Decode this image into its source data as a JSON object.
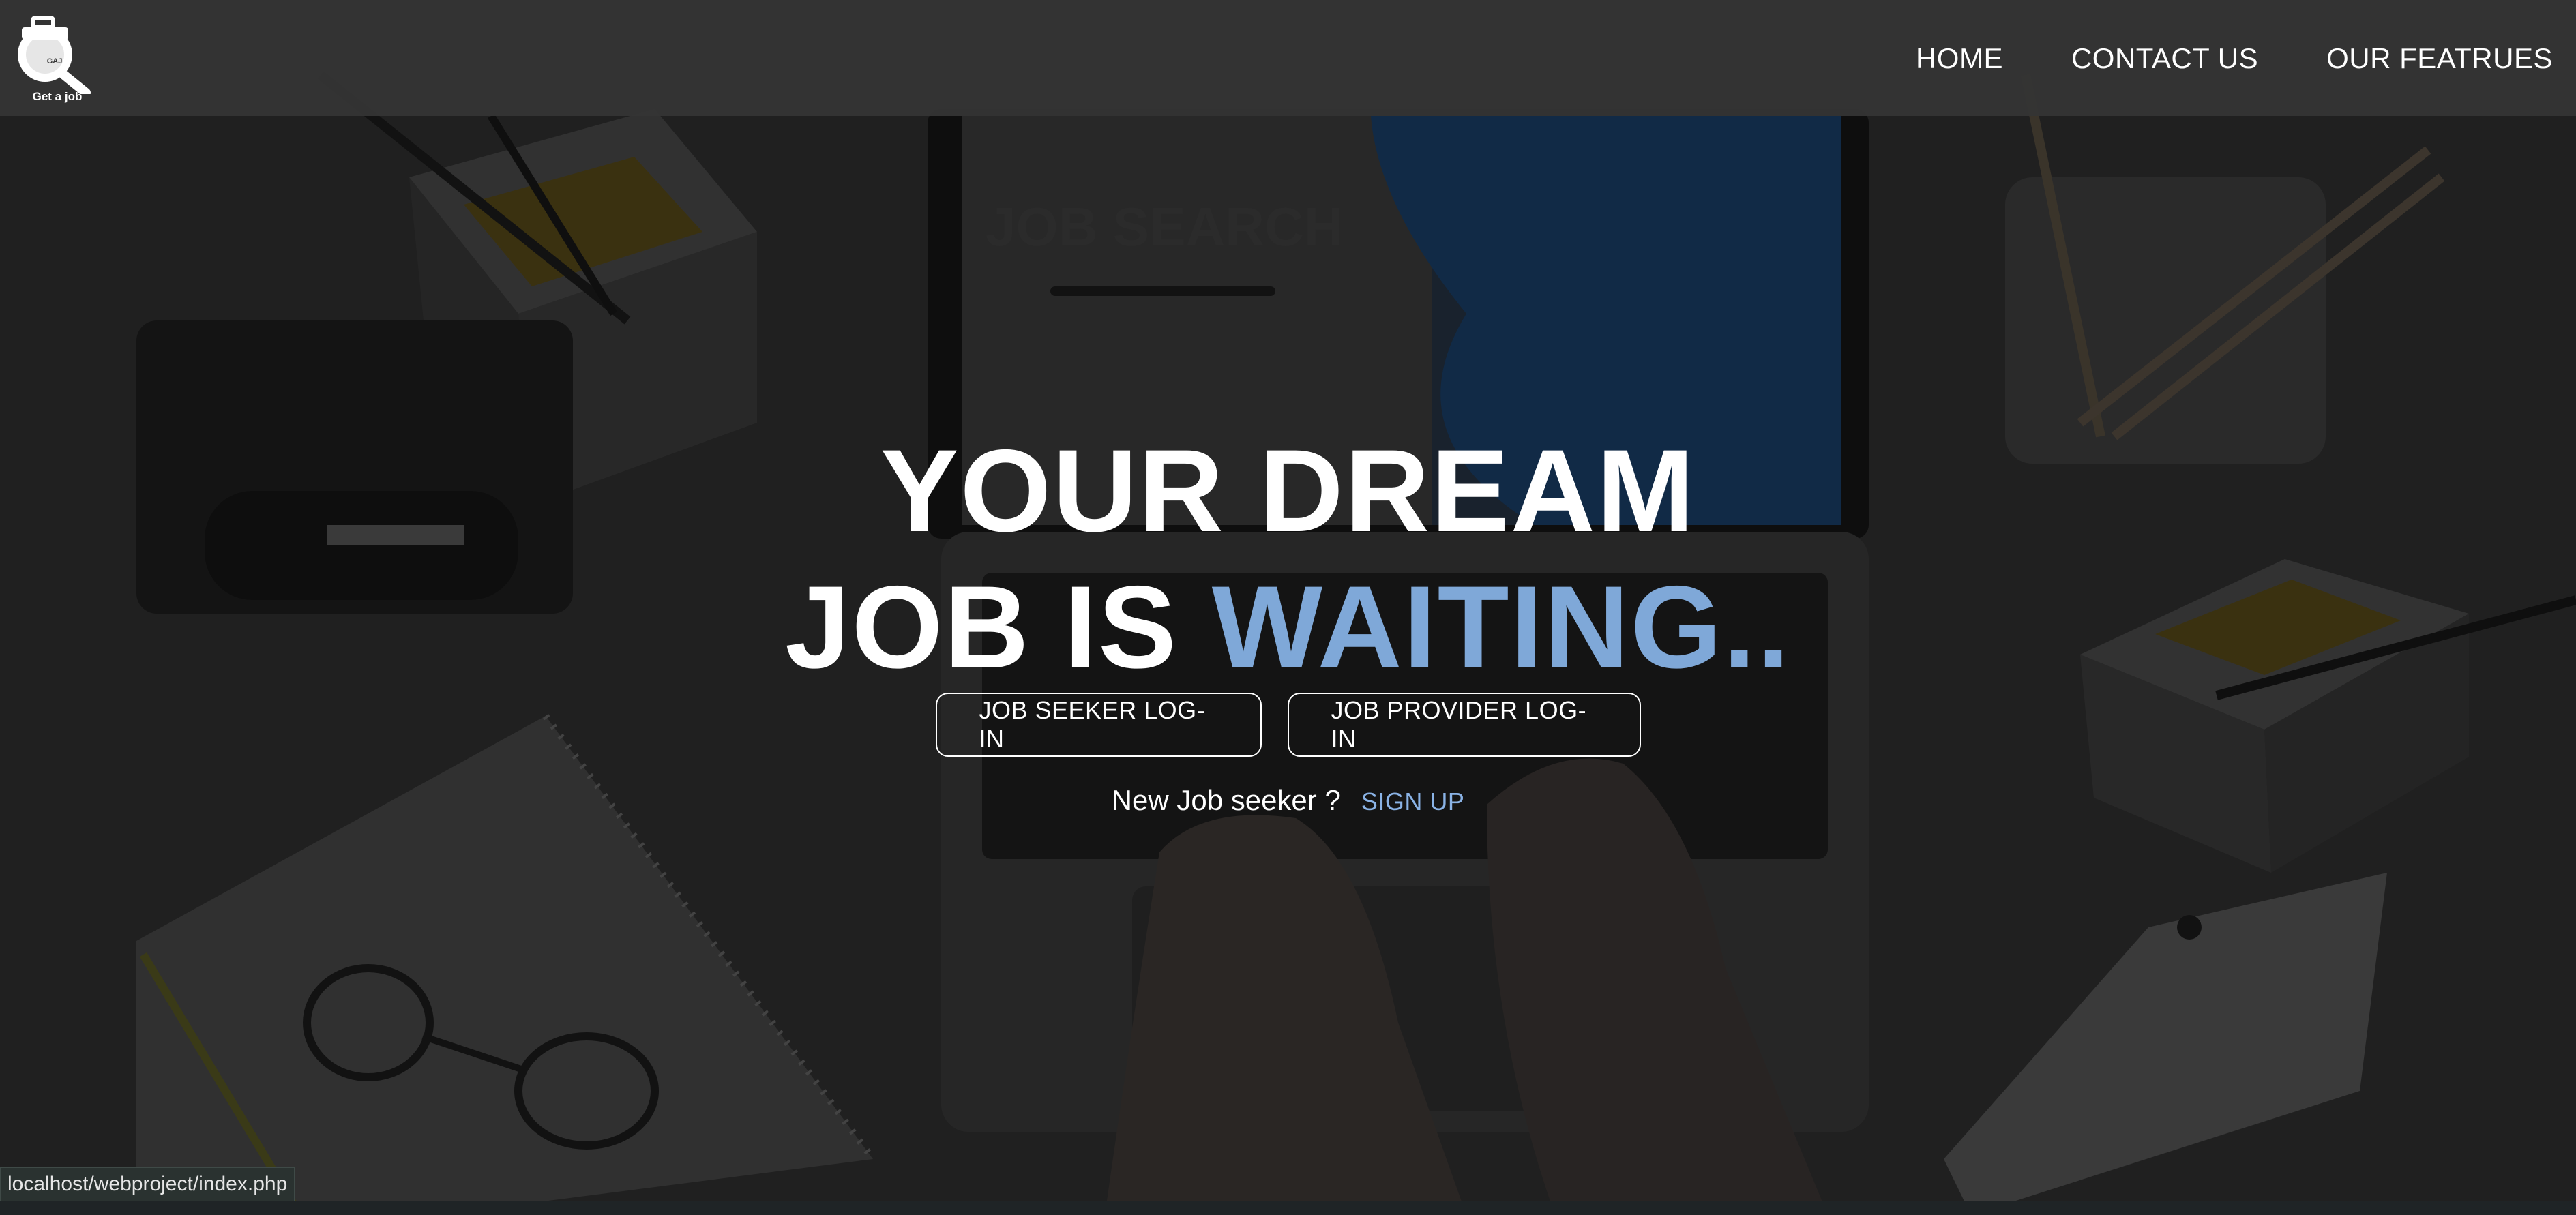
{
  "header": {
    "logo_mark": "GAJ",
    "logo_text": "Get a job",
    "nav": [
      {
        "label": "HOME"
      },
      {
        "label": "CONTACT US"
      },
      {
        "label": "OUR FEATRUES"
      }
    ]
  },
  "hero": {
    "line1": "YOUR DREAM",
    "line2_plain": "JOB IS ",
    "line2_accent": "WAITING.."
  },
  "actions": {
    "seeker_login": "JOB SEEKER LOG-IN",
    "provider_login": "JOB PROVIDER LOG-IN",
    "new_seeker_prompt": "New Job seeker ?",
    "signup_label": "SIGN UP"
  },
  "background": {
    "screen_text": "JOB SEARCH"
  },
  "status_bar": {
    "url": "localhost/webproject/index.php"
  },
  "colors": {
    "accent": "#7fa8d8",
    "signup_link": "#8ab3e6",
    "header_bg": "#343434"
  }
}
